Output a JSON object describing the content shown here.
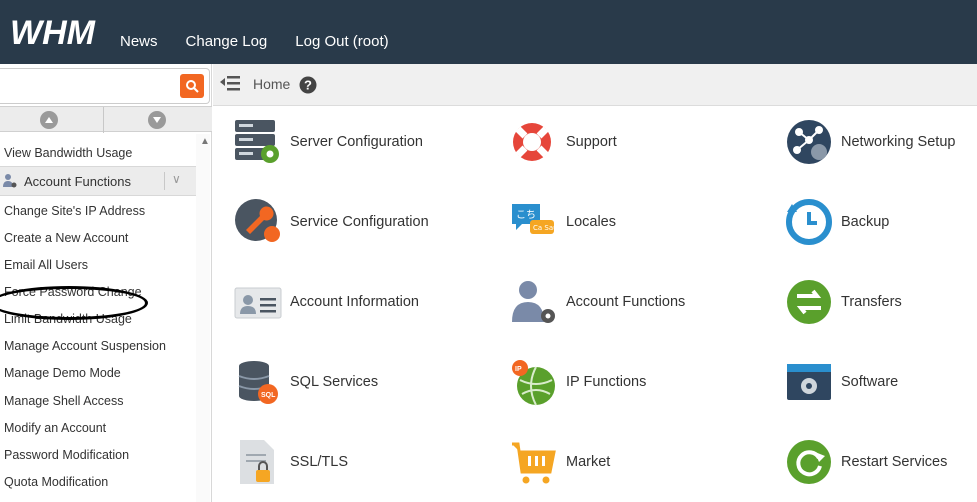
{
  "header": {
    "logo_text": "WHM",
    "nav": [
      "News",
      "Change Log",
      "Log Out (root)"
    ]
  },
  "sidebar": {
    "search": {
      "value": "",
      "placeholder": ""
    },
    "items_before": [
      "View Bandwidth Usage"
    ],
    "category": "Account Functions",
    "items_after": [
      "Change Site's IP Address",
      "Create a New Account",
      "Email All Users",
      "Force Password Change",
      "Limit Bandwidth Usage",
      "Manage Account Suspension",
      "Manage Demo Mode",
      "Manage Shell Access",
      "Modify an Account",
      "Password Modification",
      "Quota Modification"
    ]
  },
  "breadcrumb": {
    "home": "Home"
  },
  "tiles": [
    {
      "label": "Server Configuration",
      "icon": "server-config-icon"
    },
    {
      "label": "Support",
      "icon": "lifebuoy-icon"
    },
    {
      "label": "Networking Setup",
      "icon": "network-icon"
    },
    {
      "label": "Service Configuration",
      "icon": "wrench-icon"
    },
    {
      "label": "Locales",
      "icon": "speech-bubble-icon"
    },
    {
      "label": "Backup",
      "icon": "backup-clock-icon"
    },
    {
      "label": "Account Information",
      "icon": "id-card-icon"
    },
    {
      "label": "Account Functions",
      "icon": "user-gear-icon"
    },
    {
      "label": "Transfers",
      "icon": "transfer-arrows-icon"
    },
    {
      "label": "SQL Services",
      "icon": "database-icon"
    },
    {
      "label": "IP Functions",
      "icon": "globe-pin-icon"
    },
    {
      "label": "Software",
      "icon": "software-window-icon"
    },
    {
      "label": "SSL/TLS",
      "icon": "certificate-lock-icon"
    },
    {
      "label": "Market",
      "icon": "shopping-cart-icon"
    },
    {
      "label": "Restart Services",
      "icon": "restart-icon"
    }
  ],
  "colors": {
    "header_bg": "#293a4a",
    "accent": "#f26722"
  }
}
